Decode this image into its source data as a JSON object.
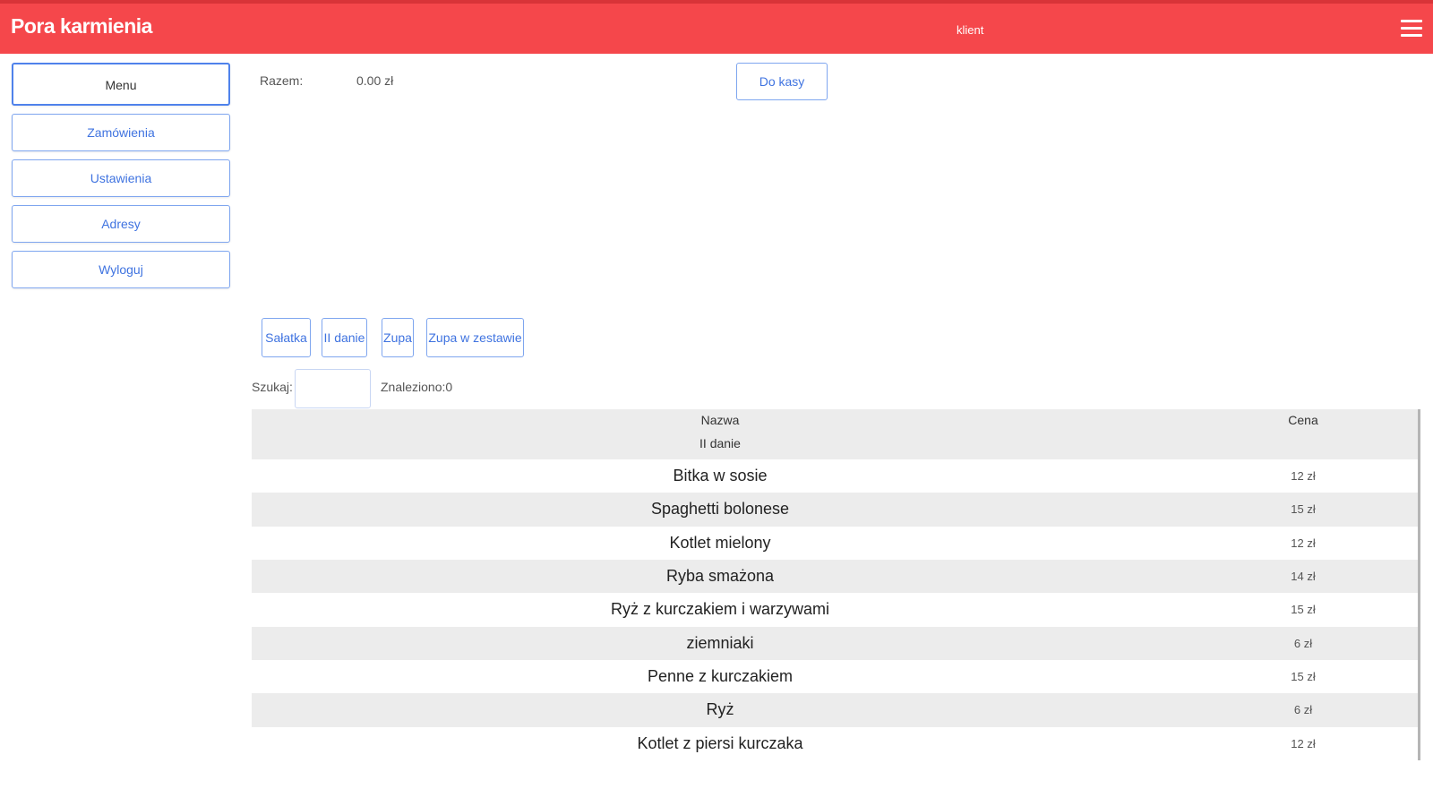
{
  "header": {
    "title": "Pora karmienia",
    "user_role": "klient",
    "menu_icon": "hamburger-icon"
  },
  "sidebar": {
    "items": [
      {
        "label": "Menu",
        "active": true
      },
      {
        "label": "Zamówienia"
      },
      {
        "label": "Ustawienia"
      },
      {
        "label": "Adresy"
      },
      {
        "label": "Wyloguj"
      }
    ]
  },
  "cart": {
    "label": "Razem:",
    "total": "0.00 zł",
    "checkout_label": "Do kasy"
  },
  "categories": [
    "Sałatka",
    "II danie",
    "Zupa",
    "Zupa w zestawie"
  ],
  "search": {
    "label": "Szukaj:",
    "value": "",
    "found": "Znaleziono:0"
  },
  "table": {
    "headers": {
      "name": "Nazwa",
      "category": "II danie",
      "price": "Cena"
    },
    "rows": [
      {
        "name": "Bitka w sosie",
        "price": "12 zł"
      },
      {
        "name": "Spaghetti bolonese",
        "price": "15 zł"
      },
      {
        "name": "Kotlet mielony",
        "price": "12 zł"
      },
      {
        "name": "Ryba smażona",
        "price": "14 zł"
      },
      {
        "name": "Ryż z kurczakiem i warzywami",
        "price": "15 zł"
      },
      {
        "name": "ziemniaki",
        "price": "6 zł"
      },
      {
        "name": "Penne z kurczakiem",
        "price": "15 zł"
      },
      {
        "name": "Ryż",
        "price": "6 zł"
      },
      {
        "name": "Kotlet z piersi kurczaka",
        "price": "12 zł"
      }
    ]
  },
  "colors": {
    "brand": "#f5474b",
    "accent": "#3f73e0",
    "row_alt": "#ececec"
  }
}
